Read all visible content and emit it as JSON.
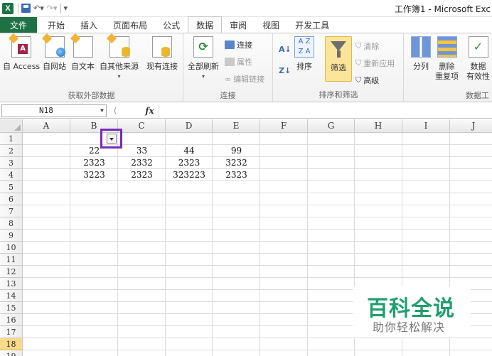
{
  "app": {
    "window_title": "工作簿1 - Microsoft Exc",
    "logo_letter": "X"
  },
  "tabs": [
    {
      "label": "文件"
    },
    {
      "label": "开始"
    },
    {
      "label": "插入"
    },
    {
      "label": "页面布局"
    },
    {
      "label": "公式"
    },
    {
      "label": "数据"
    },
    {
      "label": "审阅"
    },
    {
      "label": "视图"
    },
    {
      "label": "开发工具"
    }
  ],
  "active_tab": "数据",
  "ribbon": {
    "get_external": {
      "label": "获取外部数据",
      "buttons": [
        "自 Access",
        "自网站",
        "自文本",
        "自其他来源",
        "现有连接"
      ]
    },
    "connections": {
      "label": "连接",
      "refresh_all": "全部刷新",
      "connections_btn": "连接",
      "properties_btn": "属性",
      "edit_links_btn": "编辑链接"
    },
    "sort_filter": {
      "label": "排序和筛选",
      "sort_btn": "排序",
      "filter_btn": "筛选",
      "clear_btn": "清除",
      "reapply_btn": "重新应用",
      "advanced_btn": "高级"
    },
    "data_tools": {
      "label": "数据工",
      "split_btn": "分列",
      "remove_dup_line1": "删除",
      "remove_dup_line2": "重复项",
      "validation_line1": "数据",
      "validation_line2": "有效性"
    }
  },
  "formula_bar": {
    "name_box": "N18",
    "fx_label": "fx",
    "formula": ""
  },
  "grid": {
    "columns": [
      "A",
      "B",
      "C",
      "D",
      "E",
      "F",
      "G",
      "H",
      "I",
      "J"
    ],
    "rows": [
      "1",
      "2",
      "3",
      "4",
      "5",
      "6",
      "7",
      "8",
      "9",
      "10",
      "11",
      "12",
      "13",
      "14",
      "15",
      "16",
      "17",
      "18",
      "19"
    ],
    "selected_row": "18",
    "cells": {
      "B2": "22",
      "C2": "33",
      "D2": "44",
      "E2": "99",
      "B3": "2323",
      "C3": "2332",
      "D3": "2323",
      "E3": "3232",
      "B4": "3223",
      "C4": "2323",
      "D4": "323223",
      "E4": "2323"
    }
  },
  "watermark": {
    "title": "百科全说",
    "subtitle": "助你轻松解决"
  },
  "colors": {
    "excel_green": "#1e7145",
    "highlight_purple": "#7a2bb5",
    "filter_active": "#fce59a",
    "watermark_green": "#1f9e6e"
  }
}
